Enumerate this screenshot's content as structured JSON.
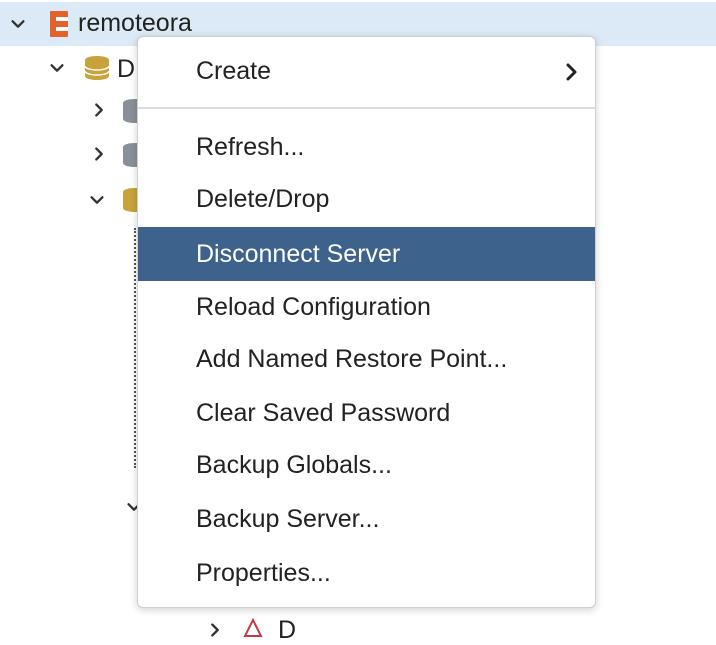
{
  "tree": {
    "root": {
      "label": "remoteora",
      "icon": "edb-server-icon",
      "expanded": true
    },
    "child_db_partial_label": "D",
    "bottom_partial_label": "D"
  },
  "context_menu": {
    "items": [
      {
        "label": "Create",
        "has_submenu": true
      },
      {
        "label": "Refresh..."
      },
      {
        "label": "Delete/Drop"
      },
      {
        "label": "Disconnect Server",
        "highlighted": true
      },
      {
        "label": "Reload Configuration"
      },
      {
        "label": "Add Named Restore Point..."
      },
      {
        "label": "Clear Saved Password"
      },
      {
        "label": "Backup Globals..."
      },
      {
        "label": "Backup Server..."
      },
      {
        "label": "Properties..."
      }
    ]
  },
  "colors": {
    "selection_row": "#dce9f6",
    "menu_highlight": "#3d628b",
    "server_icon": "#e2622b",
    "database_icon_gold": "#c8a23a",
    "database_icon_gray": "#8a9099"
  }
}
